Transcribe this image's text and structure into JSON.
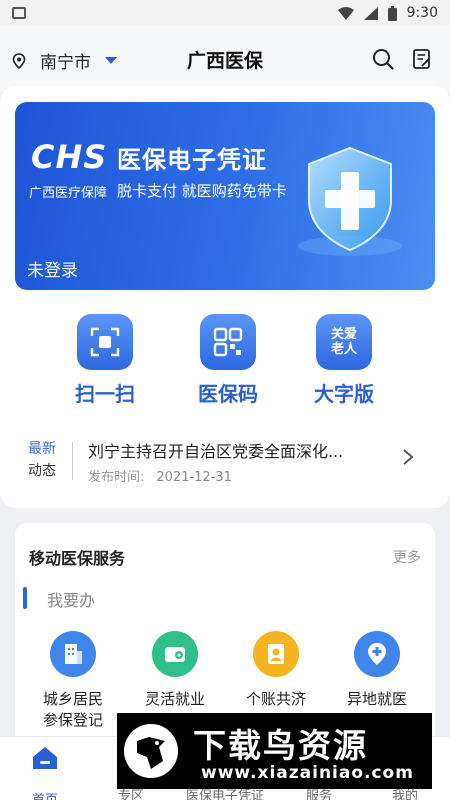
{
  "status_bar": {
    "time": "9:30"
  },
  "header": {
    "city": "南宁市",
    "title": "广西医保"
  },
  "banner": {
    "logo_text": "CHS",
    "title": "医保电子凭证",
    "subtitle": "广西医疗保障",
    "slogan": "脱卡支付 就医购药免带卡",
    "login_status": "未登录"
  },
  "quick_actions": [
    {
      "label": "扫一扫"
    },
    {
      "label": "医保码"
    },
    {
      "label": "大字版",
      "icon_text_1": "关爱",
      "icon_text_2": "老人"
    }
  ],
  "news": {
    "tag_line1": "最新",
    "tag_line2": "动态",
    "title": "刘宁主持召开自治区党委全面深化...",
    "date_label": "发布时间:",
    "date": "2021-12-31"
  },
  "services": {
    "title": "移动医保服务",
    "more": "更多",
    "section_label": "我要办",
    "items": [
      {
        "line1": "城乡居民",
        "line2": "参保登记"
      },
      {
        "line1": "灵活就业",
        "line2": ""
      },
      {
        "line1": "个账共济",
        "line2": ""
      },
      {
        "line1": "异地就医",
        "line2": ""
      }
    ]
  },
  "tabbar": {
    "items": [
      {
        "label": "首页"
      },
      {
        "label": "专区"
      },
      {
        "label": "医保电子凭证"
      },
      {
        "label": "服务"
      },
      {
        "label": "我的"
      }
    ]
  },
  "watermark": {
    "text_cn": "下载鸟资源",
    "url": "www.xiazainiao.com"
  },
  "colors": {
    "primary": "#2a5fd2",
    "banner_start": "#1d55d6",
    "banner_end": "#4a8ff2"
  }
}
